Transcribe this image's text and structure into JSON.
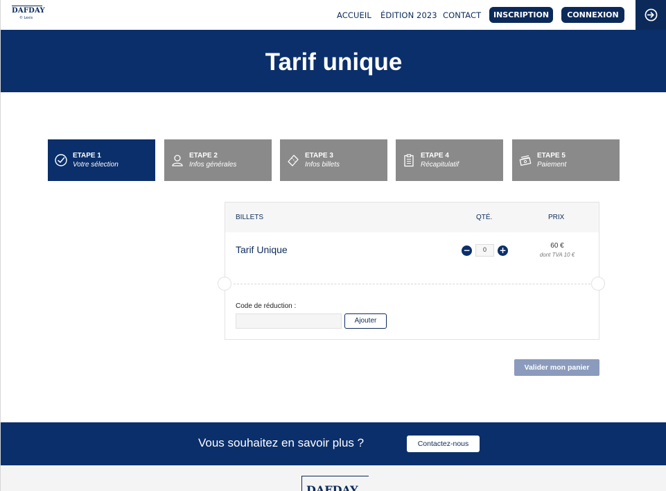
{
  "brand": {
    "logo_text": "DAFDAY",
    "logo_sub": "© Lexis"
  },
  "nav": {
    "items": [
      "ACCUEIL",
      "ÉDITION 2023",
      "CONTACT"
    ],
    "register_label": "INSCRIPTION",
    "login_label": "CONNEXION",
    "login_icon": "sign-in-icon"
  },
  "hero": {
    "title": "Tarif unique"
  },
  "steps": [
    {
      "label": "ETAPE 1",
      "sub": "Votre sélection",
      "icon": "check-circle-icon",
      "active": true
    },
    {
      "label": "ETAPE 2",
      "sub": "Infos générales",
      "icon": "user-icon",
      "active": false
    },
    {
      "label": "ETAPE 3",
      "sub": "Infos billets",
      "icon": "ticket-icon",
      "active": false
    },
    {
      "label": "ETAPE 4",
      "sub": "Récapitulatif",
      "icon": "clipboard-icon",
      "active": false
    },
    {
      "label": "ETAPE 5",
      "sub": "Paiement",
      "icon": "money-icon",
      "active": false
    }
  ],
  "cart": {
    "headers": {
      "tickets": "BILLETS",
      "qty": "QTÉ.",
      "price": "PRIX"
    },
    "ticket": {
      "name": "Tarif Unique",
      "quantity": "0",
      "price": "60 €",
      "tax_note": "dont TVA 10 €"
    },
    "discount": {
      "label": "Code de réduction :",
      "placeholder": "",
      "apply_label": "Ajouter"
    },
    "validate_label": "Valider mon panier"
  },
  "footer": {
    "cta_text": "Vous souhaitez en savoir plus ?",
    "contact_label": "Contactez-nous",
    "logo_text": "DAFDAY"
  },
  "colors": {
    "primary": "#0b2f6b",
    "inactive_step": "#8a8a8a",
    "disabled_button": "#8b9bbd"
  }
}
